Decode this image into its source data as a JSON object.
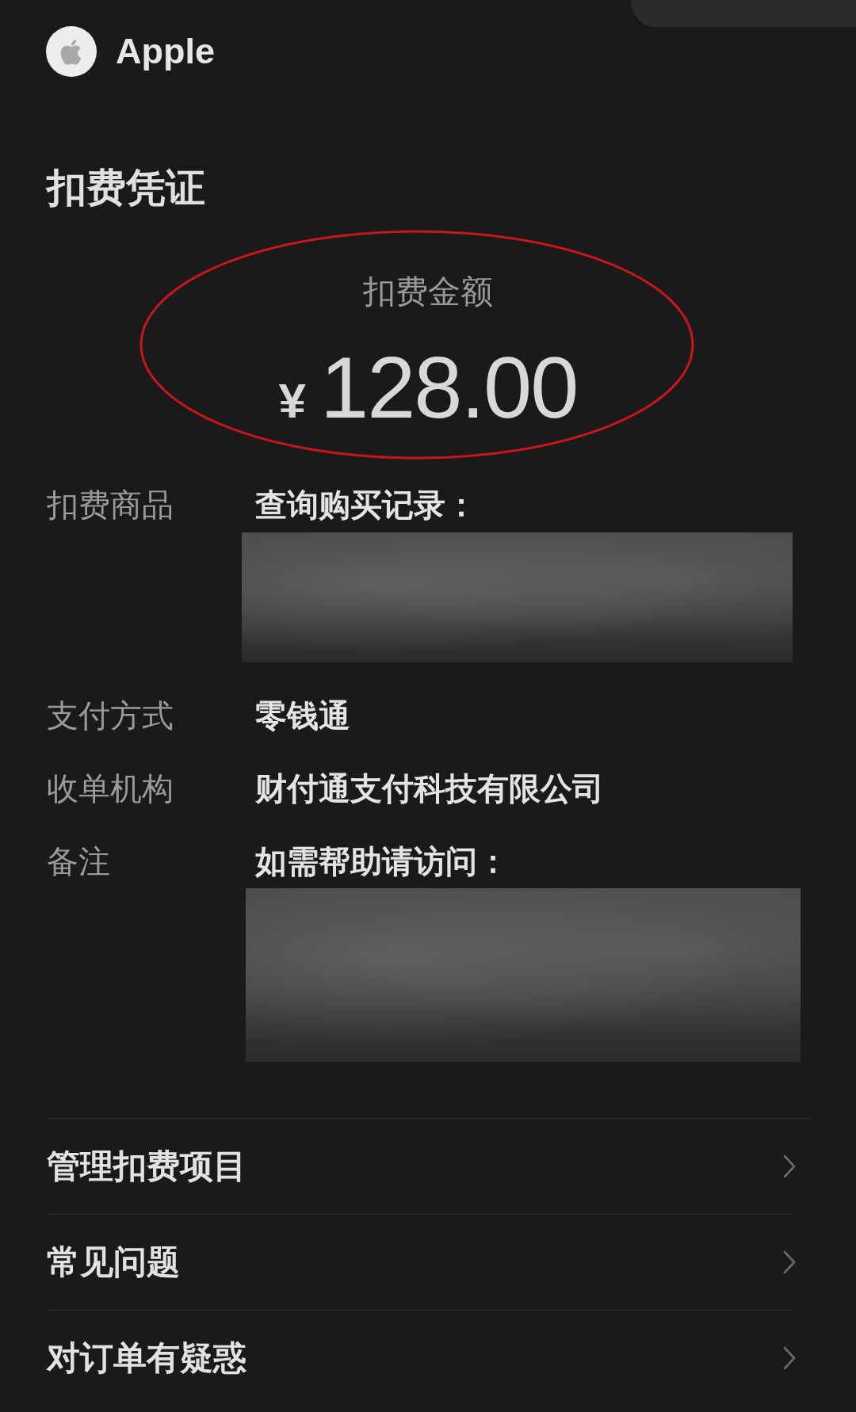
{
  "header": {
    "brand": "Apple"
  },
  "title": "扣费凭证",
  "amount": {
    "label": "扣费金额",
    "currency": "¥",
    "value": "128.00",
    "circled": true
  },
  "details": [
    {
      "label": "扣费商品",
      "value": "查询购买记录：",
      "redacted": true
    },
    {
      "label": "支付方式",
      "value": "零钱通",
      "redacted": false
    },
    {
      "label": "收单机构",
      "value": "财付通支付科技有限公司",
      "redacted": false
    },
    {
      "label": "备注",
      "value": "如需帮助请访问：",
      "redacted": true
    }
  ],
  "menu": [
    {
      "label": "管理扣费项目"
    },
    {
      "label": "常见问题"
    },
    {
      "label": "对订单有疑惑"
    }
  ]
}
